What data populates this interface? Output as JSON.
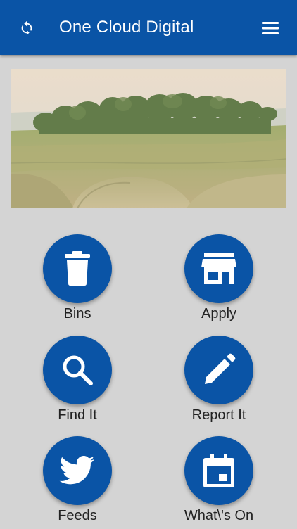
{
  "header": {
    "title": "One Cloud Digital",
    "refresh_icon": "refresh-icon",
    "menu_icon": "hamburger-menu-icon",
    "background": "#0a54a6"
  },
  "banner": {
    "subject": "landscape-photo"
  },
  "tiles": [
    {
      "label": "Bins",
      "icon": "trash-bin-icon"
    },
    {
      "label": "Apply",
      "icon": "storefront-icon"
    },
    {
      "label": "Find It",
      "icon": "search-icon"
    },
    {
      "label": "Report It",
      "icon": "pencil-icon"
    },
    {
      "label": "Feeds",
      "icon": "twitter-bird-icon"
    },
    {
      "label": "What\\'s On",
      "icon": "calendar-icon"
    }
  ],
  "colors": {
    "accent": "#0a54a6",
    "page_background": "#d4d4d4",
    "label_text": "#222222"
  }
}
